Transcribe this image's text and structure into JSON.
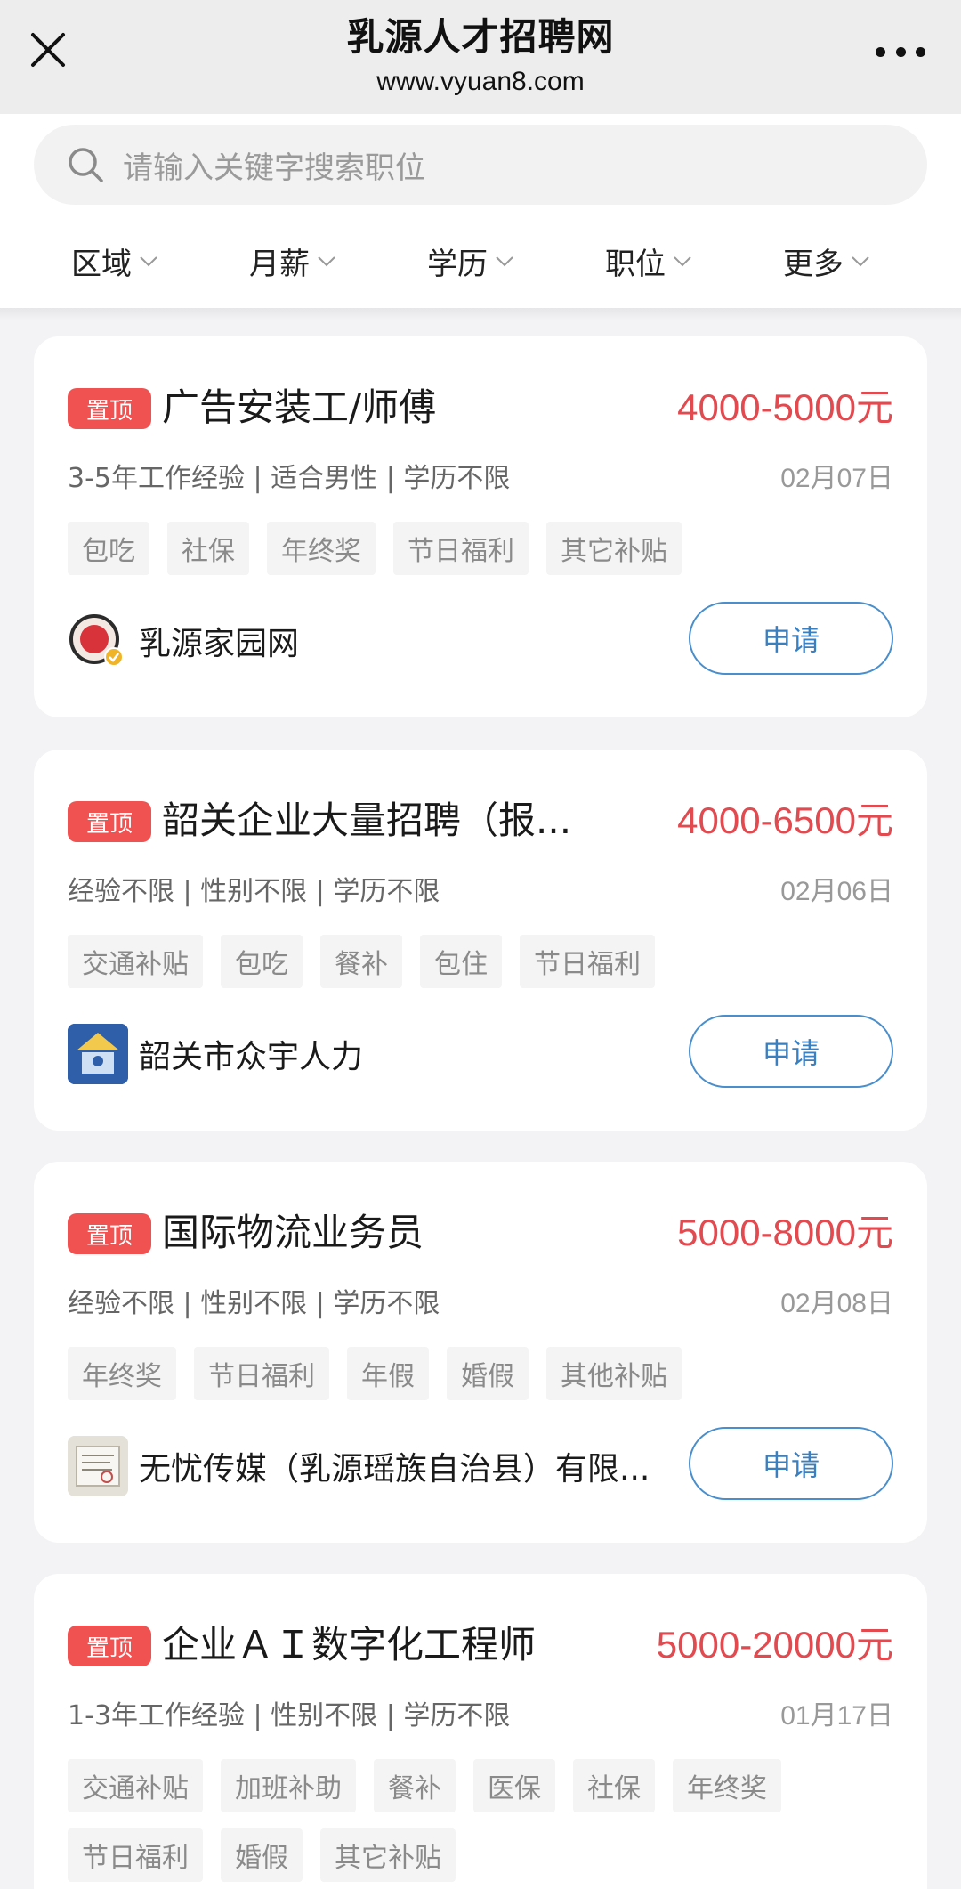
{
  "header": {
    "title": "乳源人才招聘网",
    "url": "www.vyuan8.com",
    "close_icon": "close-icon",
    "more_icon": "more-dots-icon"
  },
  "search": {
    "placeholder": "请输入关键字搜索职位",
    "icon": "search-icon"
  },
  "filters": [
    {
      "label": "区域"
    },
    {
      "label": "月薪"
    },
    {
      "label": "学历"
    },
    {
      "label": "职位"
    },
    {
      "label": "更多"
    }
  ],
  "jobs": [
    {
      "badge": "置顶",
      "title": "广告安装工/师傅",
      "salary": "4000-5000元",
      "requirements": "3-5年工作经验 | 适合男性 | 学历不限",
      "date": "02月07日",
      "tags": [
        "包吃",
        "社保",
        "年终奖",
        "节日福利",
        "其它补贴"
      ],
      "company": "乳源家园网",
      "apply_label": "申请"
    },
    {
      "badge": "置顶",
      "title": "韶关企业大量招聘（报...",
      "salary": "4000-6500元",
      "requirements": "经验不限 | 性别不限 | 学历不限",
      "date": "02月06日",
      "tags": [
        "交通补贴",
        "包吃",
        "餐补",
        "包住",
        "节日福利"
      ],
      "company": "韶关市众宇人力",
      "apply_label": "申请"
    },
    {
      "badge": "置顶",
      "title": "国际物流业务员",
      "salary": "5000-8000元",
      "requirements": "经验不限 | 性别不限 | 学历不限",
      "date": "02月08日",
      "tags": [
        "年终奖",
        "节日福利",
        "年假",
        "婚假",
        "其他补贴"
      ],
      "company": "无忧传媒（乳源瑶族自治县）有限...",
      "apply_label": "申请"
    },
    {
      "badge": "置顶",
      "title": "企业ＡＩ数字化工程师",
      "salary": "5000-20000元",
      "requirements": "1-3年工作经验 | 性别不限 | 学历不限",
      "date": "01月17日",
      "tags": [
        "交通补贴",
        "加班补助",
        "餐补",
        "医保",
        "社保",
        "年终奖",
        "节日福利",
        "婚假",
        "其它补贴"
      ]
    }
  ],
  "colors": {
    "accent_red": "#e24a4f",
    "badge_red": "#f05252",
    "apply_blue": "#3a7fc0"
  }
}
